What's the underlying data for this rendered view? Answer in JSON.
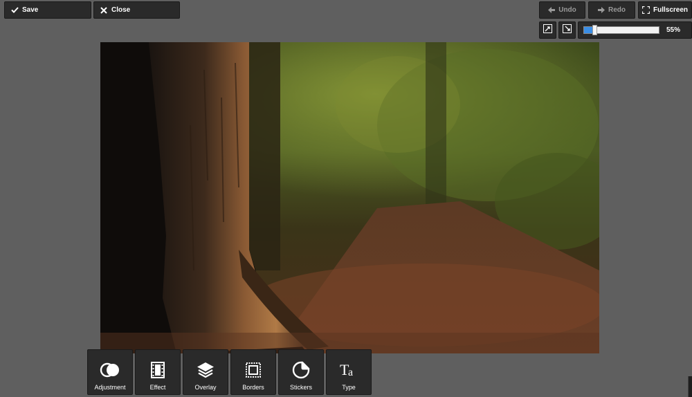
{
  "header": {
    "save_label": "Save",
    "close_label": "Close",
    "undo_label": "Undo",
    "redo_label": "Redo",
    "fullscreen_label": "Fullscreen"
  },
  "zoom": {
    "value_label": "55%",
    "level": 0.14
  },
  "tools": [
    {
      "label": "Adjustment",
      "icon": "adjustment-icon"
    },
    {
      "label": "Effect",
      "icon": "film-icon"
    },
    {
      "label": "Overlay",
      "icon": "layers-icon"
    },
    {
      "label": "Borders",
      "icon": "frame-icon"
    },
    {
      "label": "Stickers",
      "icon": "sticker-icon"
    },
    {
      "label": "Type",
      "icon": "type-icon"
    }
  ],
  "colors": {
    "background": "#5f5f5f",
    "button": "#2a2a2a",
    "zoom_fill": "#3a8ee6"
  }
}
